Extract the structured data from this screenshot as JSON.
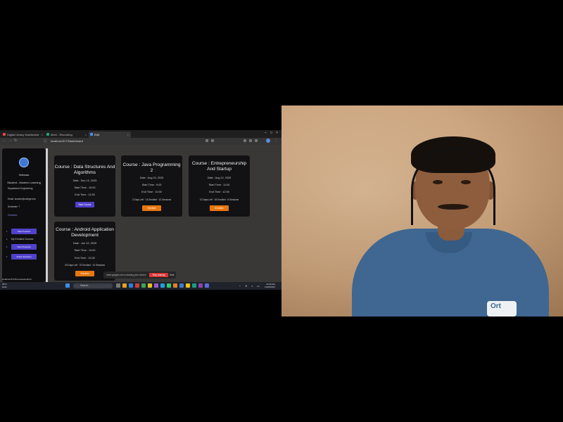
{
  "browser": {
    "tabs": [
      {
        "label": "Digital Library Dashboard"
      },
      {
        "label": "Meet - Recording"
      },
      {
        "label": "Edit"
      }
    ],
    "url": "localhost:5173/dashboard"
  },
  "sidebar": {
    "name": "Vishwas",
    "role": "Student - Modern Learning",
    "info_lines": [
      "Department: Engineering",
      "Email: student@college.edu",
      "Semester: 7"
    ],
    "section_label": "Overview",
    "menu": [
      {
        "label": "View Courses",
        "style": "button"
      },
      {
        "label": "My Enrolled Courses",
        "style": "link"
      },
      {
        "label": "View Progress",
        "style": "button"
      },
      {
        "label": "Active Sessions",
        "style": "button"
      }
    ]
  },
  "courses": [
    {
      "title": "Course : Data Structures And Algorithms",
      "date": "Date : Dec 10, 2025",
      "start": "Start Time : 10:00",
      "end": "End Time : 11:30",
      "button": "Start Course",
      "button_color": "#5141cc"
    },
    {
      "title": "Course : Java Programming 2",
      "date": "Date : Aug 24, 2025",
      "start": "Start Time : 9:00",
      "end": "End Time : 10:00",
      "extra": "2 Days Left · 14 Enrolled · 12 Sessions",
      "button": "Enrolled",
      "button_color": "#e8760f"
    },
    {
      "title": "Course : Entrepreneurship And Startup",
      "date": "Date : Aug 12, 2025",
      "start": "Start Time : 11:00",
      "end": "End Time : 12:30",
      "extra": "10 Days Left · 18 Enrolled · 8 Sessions",
      "button": "Enrolled",
      "button_color": "#e8760f"
    },
    {
      "title": "Course : Android Application Development",
      "date": "Date : Jun 19, 2025",
      "start": "Start Time : 14:00",
      "end": "End Time : 15:30",
      "extra": "40 Days Left · 22 Enrolled · 10 Sessions",
      "button": "Enrolled",
      "button_color": "#e8760f"
    }
  ],
  "share_bar": {
    "text": "meet.google.com is sharing your screen",
    "stop": "Stop sharing",
    "hide": "Hide"
  },
  "status_url": "localhost:5173/courses/android",
  "taskbar": {
    "weather": "29°C",
    "weather_desc": "Haze",
    "search_placeholder": "Search",
    "time": "10:36 AM",
    "date": "11/26/2024"
  },
  "webcam": {
    "badge_text": "Ort"
  }
}
